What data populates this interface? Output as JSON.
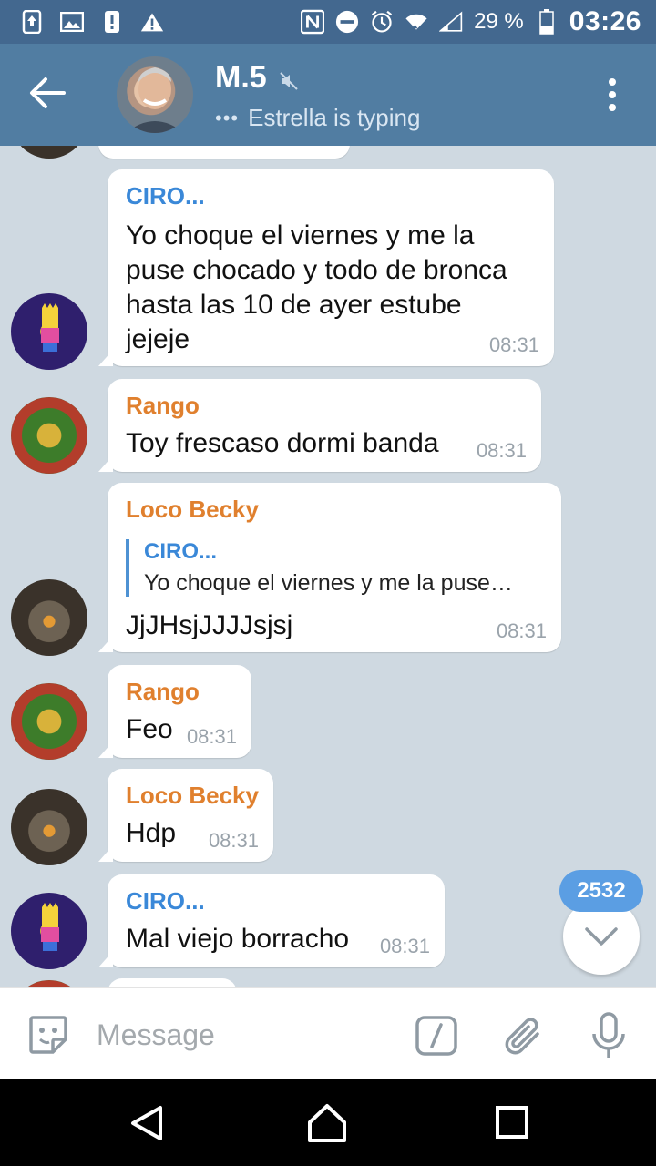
{
  "status_bar": {
    "battery_percent": "29 %",
    "time": "03:26"
  },
  "header": {
    "title": "M.5",
    "status": "Estrella is typing",
    "typing_dots": "•••"
  },
  "messages": [
    {
      "sender": "CIRO...",
      "sender_color": "#3a88d8",
      "text_lines": [
        "Yo choque el viernes y me la",
        "puse chocado y todo de bronca",
        "hasta las 10 de ayer estube",
        "jejeje"
      ],
      "time": "08:31",
      "avatar": "bart"
    },
    {
      "sender": "Rango",
      "sender_color": "#e0802e",
      "text": "Toy frescaso dormi banda",
      "time": "08:31",
      "avatar": "rango"
    },
    {
      "sender": "Loco Becky",
      "sender_color": "#e0802e",
      "reply_to": {
        "name": "CIRO...",
        "text": "Yo choque el viernes y me la puse…"
      },
      "text": "JjJHsjJJJJsjsj",
      "time": "08:31",
      "avatar": "loco"
    },
    {
      "sender": "Rango",
      "sender_color": "#e0802e",
      "text": "Feo",
      "time": "08:31",
      "avatar": "rango"
    },
    {
      "sender": "Loco Becky",
      "sender_color": "#e0802e",
      "text": "Hdp",
      "time": "08:31",
      "avatar": "loco"
    },
    {
      "sender": "CIRO...",
      "sender_color": "#3a88d8",
      "text": "Mal viejo borracho",
      "time": "08:31",
      "avatar": "bart"
    }
  ],
  "unread_count": "2532",
  "composer": {
    "placeholder": "Message"
  },
  "colors": {
    "app_bar": "#517da2",
    "status_bar": "#43688f",
    "accent_blue": "#5b9ee3",
    "orange_name": "#e0802e",
    "blue_name": "#3a88d8"
  },
  "icons": {
    "back": "arrow-left-icon",
    "mute": "mute-icon",
    "menu": "more-vert-icon",
    "emoji": "sticker-icon",
    "command": "slash-command-icon",
    "attach": "paperclip-icon",
    "mic": "microphone-icon",
    "scroll": "chevron-down-icon"
  }
}
